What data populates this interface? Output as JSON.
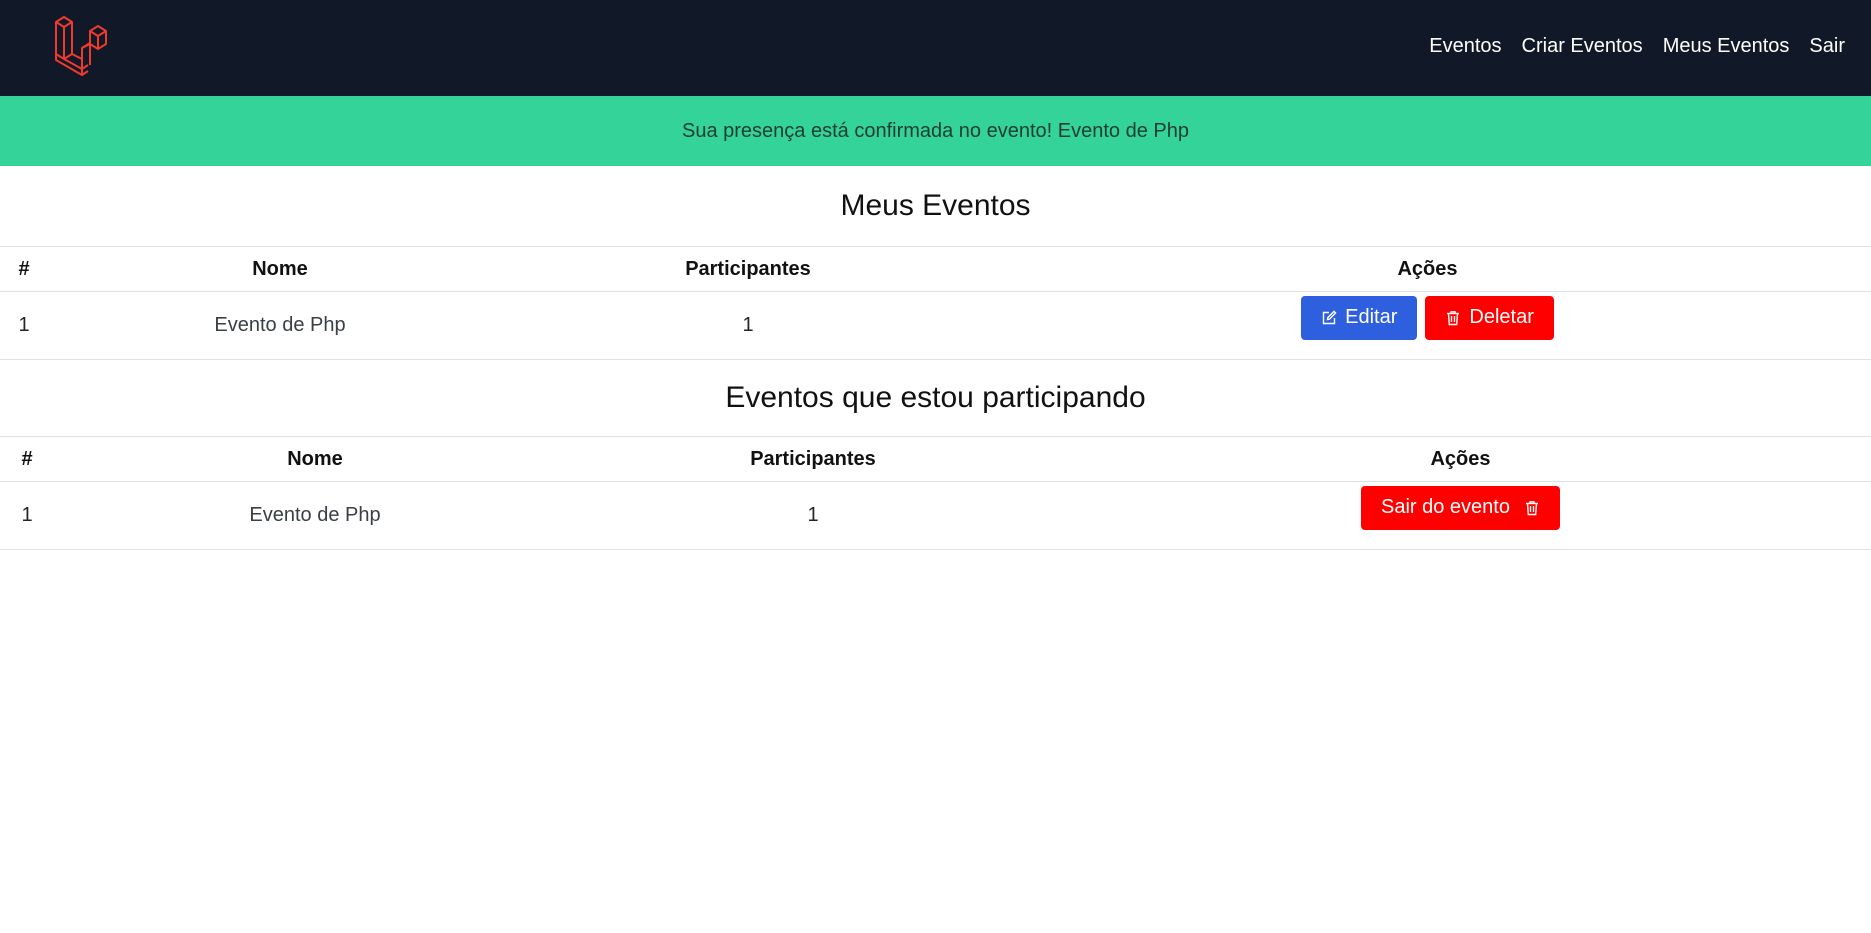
{
  "nav": {
    "links": [
      "Eventos",
      "Criar Eventos",
      "Meus Eventos",
      "Sair"
    ]
  },
  "alert": {
    "message": "Sua presença está confirmada no evento! Evento de Php"
  },
  "my_events": {
    "title": "Meus Eventos",
    "headers": [
      "#",
      "Nome",
      "Participantes",
      "Ações"
    ],
    "rows": [
      {
        "num": "1",
        "name": "Evento de Php",
        "participants": "1"
      }
    ],
    "edit_label": "Editar",
    "delete_label": "Deletar"
  },
  "participating": {
    "title": "Eventos que estou participando",
    "headers": [
      "#",
      "Nome",
      "Participantes",
      "Ações"
    ],
    "rows": [
      {
        "num": "1",
        "name": "Evento de Php",
        "participants": "1"
      }
    ],
    "leave_label": "Sair do evento"
  },
  "colors": {
    "navbar": "#111827",
    "alert": "#34d399",
    "edit_button": "#2d5fde",
    "delete_button": "#ff0000",
    "logo": "#ef3b2d"
  },
  "icons": {
    "logo": "laravel-logo-icon",
    "edit": "edit-icon",
    "delete": "trash-icon"
  }
}
